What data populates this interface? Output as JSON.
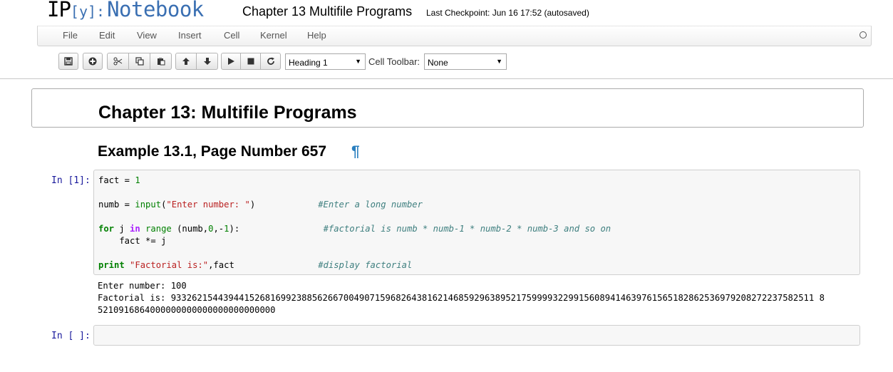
{
  "header": {
    "logo_ip": "IP",
    "logo_y": "[y]:",
    "logo_notebook": "Notebook",
    "title": "Chapter 13 Multifile Programs",
    "checkpoint": "Last Checkpoint: Jun 16 17:52 (autosaved)"
  },
  "menu": {
    "items": [
      "File",
      "Edit",
      "View",
      "Insert",
      "Cell",
      "Kernel",
      "Help"
    ]
  },
  "toolbar": {
    "buttons": [
      "save-icon",
      "insert-cell-icon",
      "cut-icon",
      "copy-icon",
      "paste-icon",
      "move-up-icon",
      "move-down-icon",
      "run-icon",
      "stop-icon",
      "restart-icon"
    ],
    "cell_type_value": "Heading 1",
    "celltoolbar_label": "Cell Toolbar:",
    "celltoolbar_value": "None"
  },
  "notebook": {
    "heading1": "Chapter 13: Multifile Programs",
    "heading2": "Example 13.1, Page Number 657",
    "pilcrow": "¶",
    "cells": [
      {
        "prompt": "In [1]:",
        "code": [
          "fact = 1",
          "",
          "numb = input(\"Enter number: \")            #Enter a long number",
          "",
          "for j in range (numb,0,-1):                #factorial is numb * numb-1 * numb-2 * numb-3 and so on",
          "    fact *= j",
          "",
          "print \"Factorial is:\",fact                #display factorial"
        ],
        "output": [
          "Enter number: 100",
          "Factorial is: 933262154439441526816992388562667004907159682643816214685929638952175999932299156089414639761565182862536979208272237582511 8",
          "5210916864000000000000000000000000"
        ]
      },
      {
        "prompt": "In [ ]:",
        "code": []
      }
    ]
  },
  "colors": {
    "accent": "#3a6fb2",
    "keyword": "#008000",
    "string": "#ba2121",
    "comment": "#408080",
    "prompt": "#1a1a9c"
  }
}
